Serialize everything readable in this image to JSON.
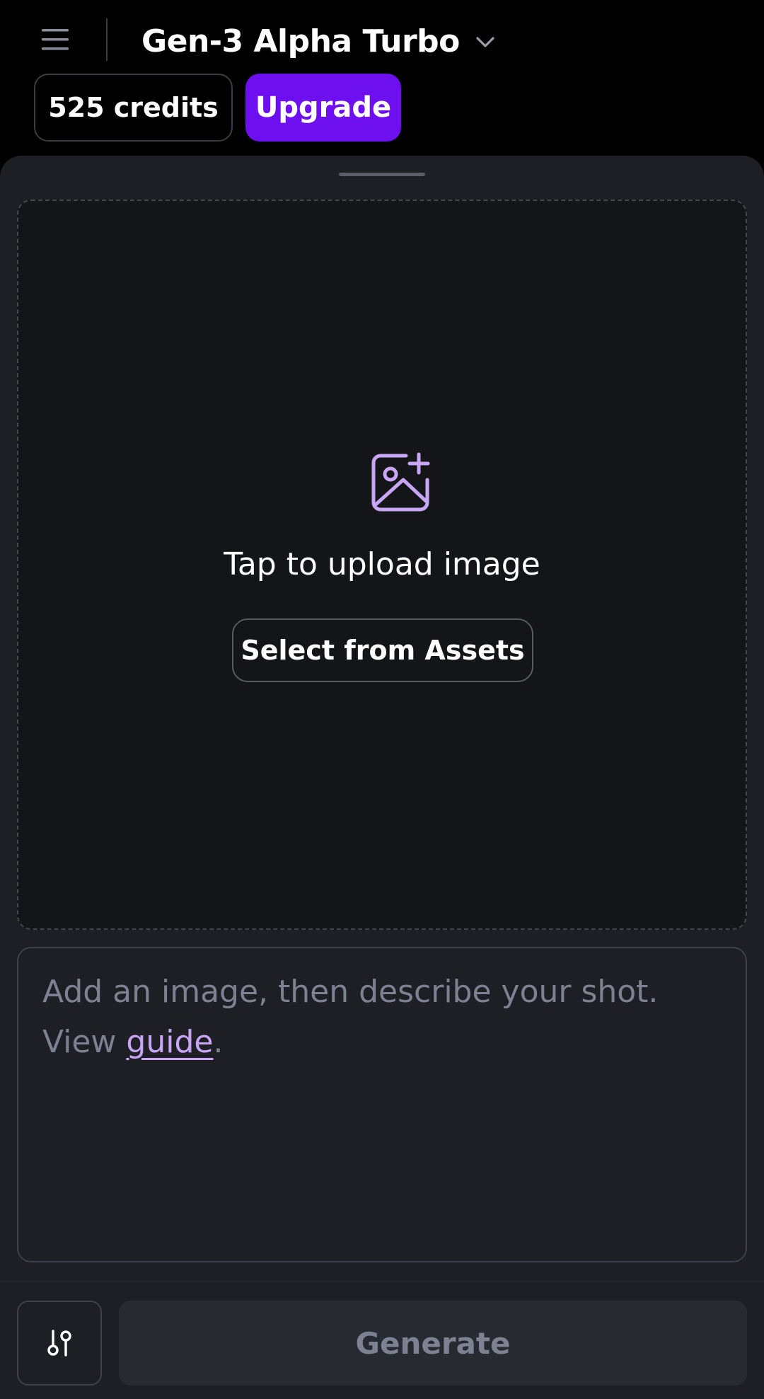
{
  "header": {
    "menu_icon": "hamburger-menu-icon",
    "model_name": "Gen-3 Alpha Turbo",
    "model_dropdown_icon": "chevron-down-icon",
    "credits_label": "525 credits",
    "upgrade_label": "Upgrade"
  },
  "upload": {
    "icon": "image-add-icon",
    "title": "Tap to upload image",
    "assets_button_label": "Select from Assets"
  },
  "prompt": {
    "placeholder_text": "Add an image, then describe your shot. View ",
    "guide_link_label": "guide",
    "placeholder_suffix": "."
  },
  "footer": {
    "settings_icon": "settings-sliders-icon",
    "generate_label": "Generate"
  },
  "colors": {
    "accent": "#6d0fef",
    "link": "#c8a6f5",
    "icon_accent": "#c8a6f5",
    "background": "#000000",
    "sheet": "#1d1f24",
    "upload_area": "#141518",
    "muted_text": "#7d8293"
  }
}
